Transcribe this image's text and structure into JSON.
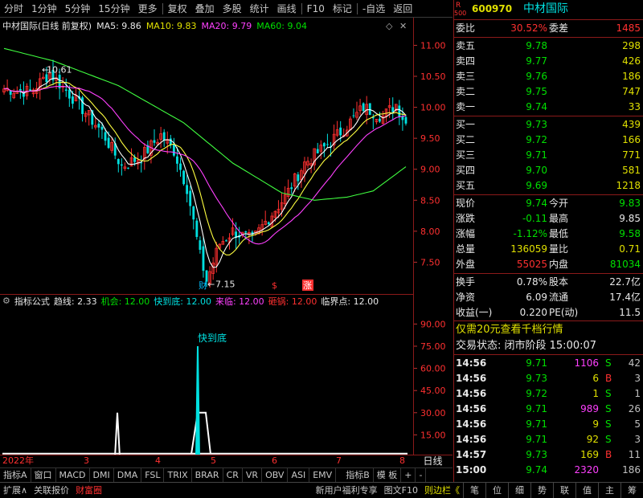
{
  "toolbar": {
    "items": [
      "分时",
      "1分钟",
      "5分钟",
      "15分钟",
      "更多",
      "复权",
      "叠加",
      "多股",
      "统计",
      "画线",
      "F10",
      "标记",
      "-自选",
      "返回"
    ]
  },
  "title": {
    "name": "中材国际(日线 前复权)",
    "ma5": "MA5: 9.86",
    "ma10": "MA10: 9.83",
    "ma20": "MA20: 9.79",
    "ma60": "MA60: 9.04",
    "high_mark": "10.61",
    "low_mark": "7.15"
  },
  "colors": {
    "up": "#ff3030",
    "down": "#00e0e0",
    "ma5": "#ffffff",
    "ma10": "#ffff40",
    "ma20": "#ff40ff",
    "ma60": "#40ff40"
  },
  "price_axis": {
    "labels": [
      "11.00",
      "10.50",
      "10.00",
      "9.50",
      "9.00",
      "8.50",
      "8.00",
      "7.50"
    ],
    "min": 7.0,
    "max": 11.2
  },
  "markers": {
    "cai": "财",
    "s": "$",
    "zhang": "涨"
  },
  "indicator": {
    "name": "指标公式",
    "qx": "趋线: 2.33",
    "jh": "机会: 12.00",
    "kdd": "快到底: 12.00",
    "ll": "来临: 12.00",
    "dg": "砸锅: 12.00",
    "ljd": "临界点: 12.00",
    "label": "快到底",
    "axis": [
      "90.00",
      "75.00",
      "60.00",
      "45.00",
      "30.00",
      "15.00"
    ]
  },
  "datebar": {
    "year": "2022年",
    "m3": "3",
    "m4": "4",
    "m5": "5",
    "m6": "6",
    "m7": "7",
    "m8": "8",
    "period": "日线"
  },
  "bottom_tabs": [
    "指标A",
    "窗口",
    "MACD",
    "DMI",
    "DMA",
    "FSL",
    "TRIX",
    "BRAR",
    "CR",
    "VR",
    "OBV",
    "ASI",
    "EMV",
    "指标B",
    "模 板",
    "+",
    "-"
  ],
  "status": {
    "left": [
      "扩展∧",
      "关联报价",
      "财富圈"
    ],
    "right": [
      "新用户福利专享",
      "图文F10",
      "则边栏《"
    ],
    "nav": [
      "笔",
      "位",
      "细",
      "势",
      "联",
      "值",
      "主",
      "筹"
    ]
  },
  "quote": {
    "code_prefix": "R",
    "code_sub": "500",
    "code": "600970",
    "name": "中材国际",
    "wb_label": "委比",
    "wb": "30.52%",
    "wc_label": "委差",
    "wc": "1485",
    "asks": [
      {
        "l": "卖五",
        "p": "9.78",
        "v": "298"
      },
      {
        "l": "卖四",
        "p": "9.77",
        "v": "426"
      },
      {
        "l": "卖三",
        "p": "9.76",
        "v": "186"
      },
      {
        "l": "卖二",
        "p": "9.75",
        "v": "747"
      },
      {
        "l": "卖一",
        "p": "9.74",
        "v": "33"
      }
    ],
    "bids": [
      {
        "l": "买一",
        "p": "9.73",
        "v": "439"
      },
      {
        "l": "买二",
        "p": "9.72",
        "v": "166"
      },
      {
        "l": "买三",
        "p": "9.71",
        "v": "771"
      },
      {
        "l": "买四",
        "p": "9.70",
        "v": "581"
      },
      {
        "l": "买五",
        "p": "9.69",
        "v": "1218"
      }
    ],
    "stats": [
      {
        "l1": "现价",
        "v1": "9.74",
        "c1": "grn",
        "l2": "今开",
        "v2": "9.83",
        "c2": "grn"
      },
      {
        "l1": "涨跌",
        "v1": "-0.11",
        "c1": "grn",
        "l2": "最高",
        "v2": "9.85",
        "c2": "wht"
      },
      {
        "l1": "涨幅",
        "v1": "-1.12%",
        "c1": "grn",
        "l2": "最低",
        "v2": "9.58",
        "c2": "grn"
      },
      {
        "l1": "总量",
        "v1": "136059",
        "c1": "yel",
        "l2": "量比",
        "v2": "0.71",
        "c2": "yel"
      },
      {
        "l1": "外盘",
        "v1": "55025",
        "c1": "red",
        "l2": "内盘",
        "v2": "81034",
        "c2": "grn"
      }
    ],
    "stats2": [
      {
        "l1": "换手",
        "v1": "0.78%",
        "l2": "股本",
        "v2": "22.7亿"
      },
      {
        "l1": "净资",
        "v1": "6.09",
        "l2": "流通",
        "v2": "17.4亿"
      },
      {
        "l1": "收益(一)",
        "v1": "0.220",
        "l2": "PE(动)",
        "v2": "11.5"
      }
    ],
    "promo": "仅需20元查看千档行情",
    "trade_state": "交易状态: 闭市阶段 15:00:07",
    "ticks": [
      {
        "t": "14:56",
        "p": "9.71",
        "v": "1106",
        "vc": "mag",
        "bs": "S",
        "n": "42"
      },
      {
        "t": "14:56",
        "p": "9.73",
        "v": "6",
        "vc": "yel",
        "bs": "B",
        "n": "3"
      },
      {
        "t": "14:56",
        "p": "9.72",
        "v": "1",
        "vc": "yel",
        "bs": "S",
        "n": "1"
      },
      {
        "t": "14:56",
        "p": "9.71",
        "v": "989",
        "vc": "mag",
        "bs": "S",
        "n": "26"
      },
      {
        "t": "14:56",
        "p": "9.71",
        "v": "9",
        "vc": "yel",
        "bs": "S",
        "n": "5"
      },
      {
        "t": "14:56",
        "p": "9.71",
        "v": "92",
        "vc": "yel",
        "bs": "S",
        "n": "3"
      },
      {
        "t": "14:57",
        "p": "9.73",
        "v": "169",
        "vc": "yel",
        "bs": "B",
        "n": "11"
      },
      {
        "t": "15:00",
        "p": "9.74",
        "v": "2320",
        "vc": "mag",
        "bs": "",
        "n": "186"
      }
    ]
  }
}
